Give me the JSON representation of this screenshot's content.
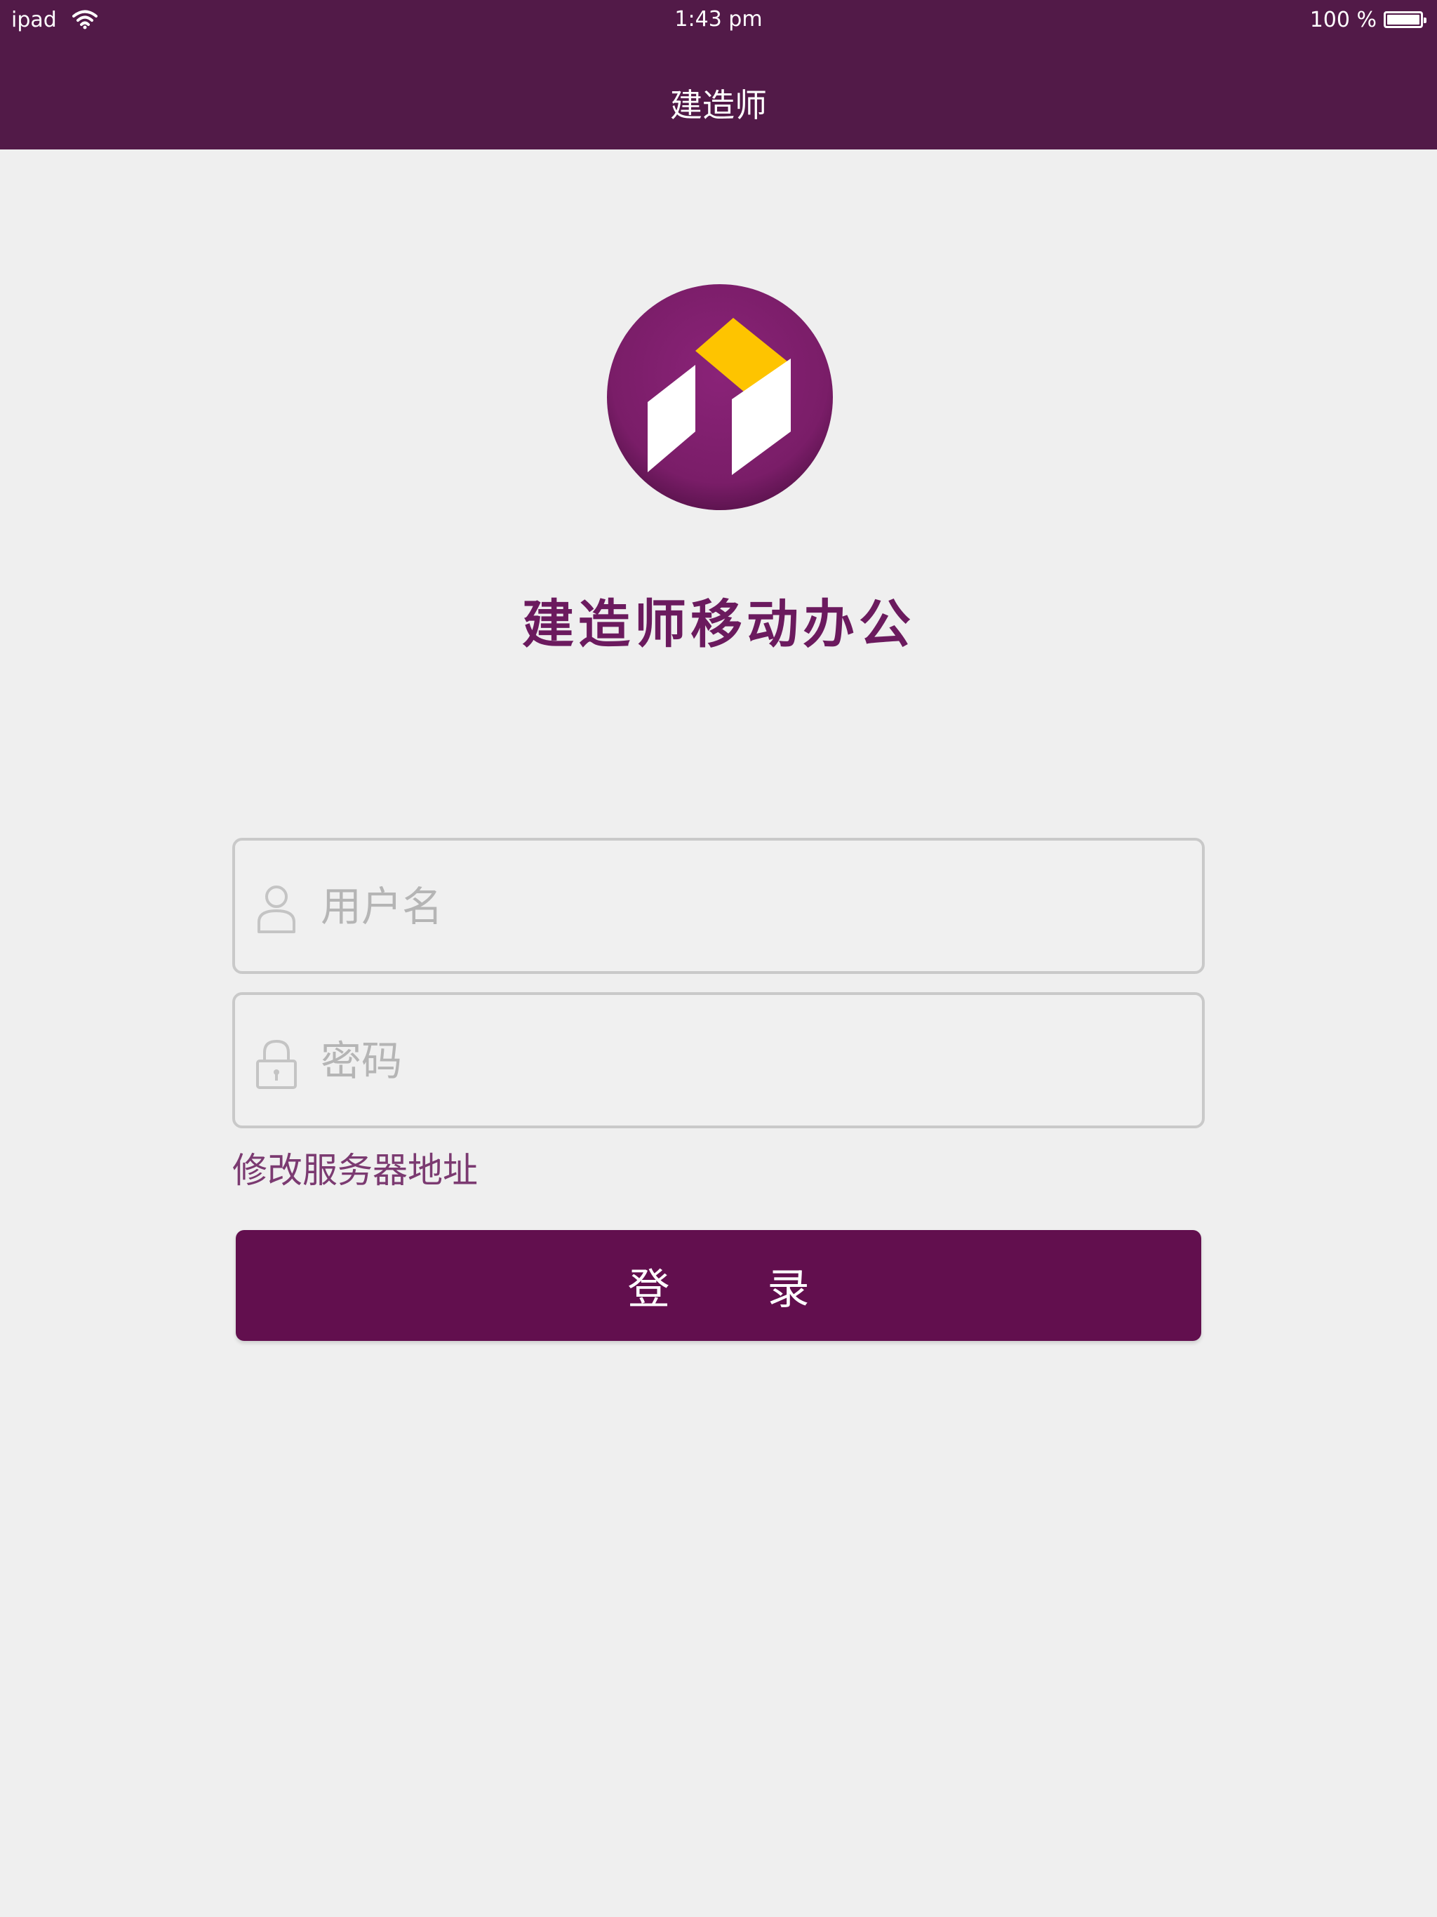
{
  "status_bar": {
    "device": "ipad",
    "time": "1:43 pm",
    "battery": "100 %",
    "icons": [
      "wifi-icon",
      "battery-icon"
    ]
  },
  "nav": {
    "title": "建造师"
  },
  "login": {
    "app_title": "建造师移动办公",
    "username_placeholder": "用户名",
    "password_placeholder": "密码",
    "change_server_label": "修改服务器地址",
    "login_button_label": "登 录",
    "icons": [
      "user-icon",
      "lock-icon"
    ]
  },
  "colors": {
    "bar_bg": "#521a48",
    "accent": "#620f4e",
    "logo_circle": "#7c1f6b",
    "logo_yellow": "#fec400",
    "page_bg": "#efefef"
  }
}
